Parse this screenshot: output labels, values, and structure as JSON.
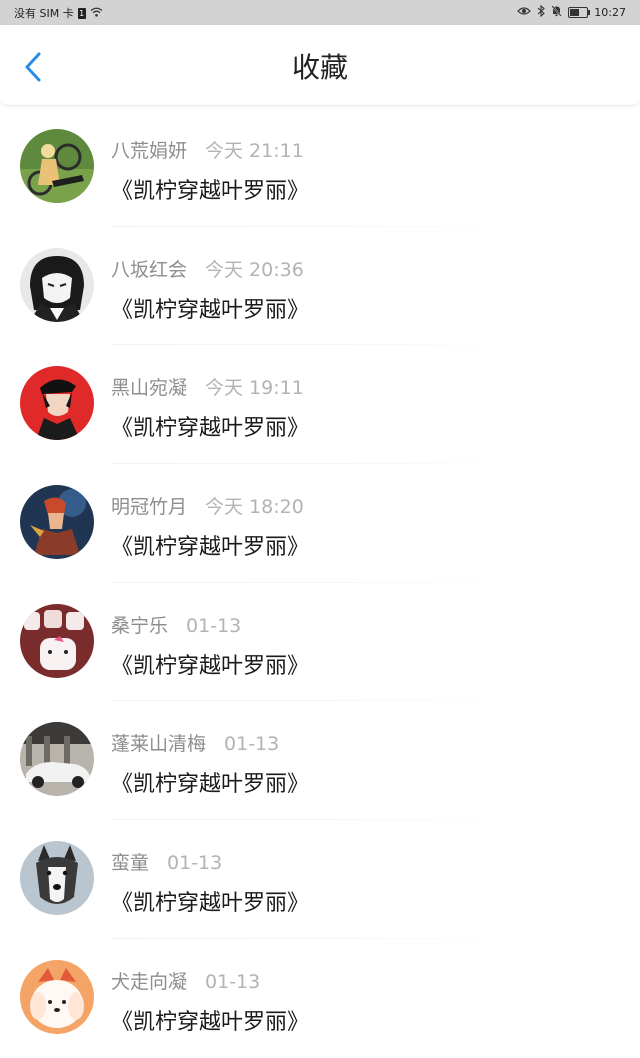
{
  "status_bar": {
    "carrier": "没有 SIM 卡",
    "sim_icon": "1",
    "time": "10:27"
  },
  "header": {
    "title": "收藏",
    "back_icon": "chevron-left-icon",
    "accent_color": "#2a8be6"
  },
  "favorites": [
    {
      "user": "八荒娟妍",
      "time": "今天 21:11",
      "title": "《凯柠穿越叶罗丽》"
    },
    {
      "user": "八坂红会",
      "time": "今天 20:36",
      "title": "《凯柠穿越叶罗丽》"
    },
    {
      "user": "黑山宛凝",
      "time": "今天 19:11",
      "title": "《凯柠穿越叶罗丽》"
    },
    {
      "user": "明冠竹月",
      "time": "今天 18:20",
      "title": "《凯柠穿越叶罗丽》"
    },
    {
      "user": "桑宁乐",
      "time": "01-13",
      "title": "《凯柠穿越叶罗丽》"
    },
    {
      "user": "蓬莱山清梅",
      "time": "01-13",
      "title": "《凯柠穿越叶罗丽》"
    },
    {
      "user": "蛮童",
      "time": "01-13",
      "title": "《凯柠穿越叶罗丽》"
    },
    {
      "user": "犬走向凝",
      "time": "01-13",
      "title": "《凯柠穿越叶罗丽》"
    }
  ]
}
